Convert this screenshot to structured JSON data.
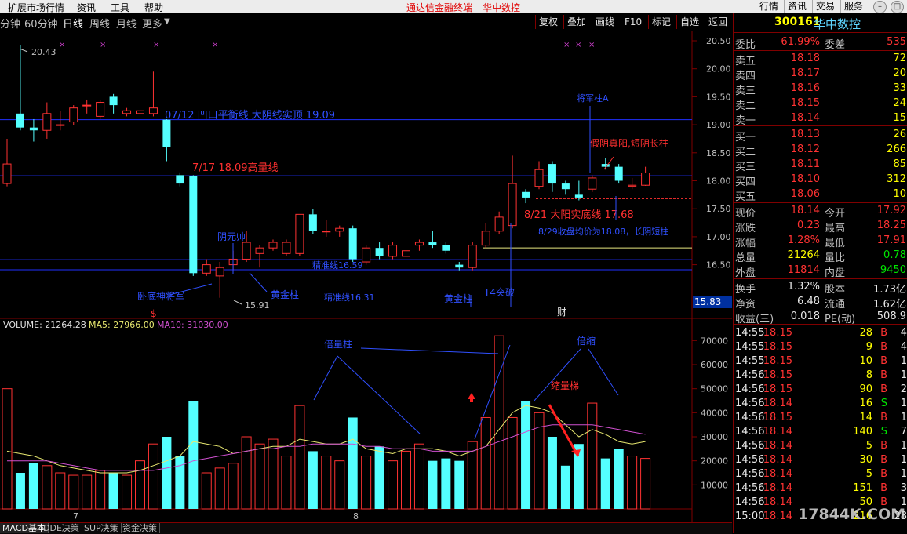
{
  "menu": {
    "items": [
      "扩展市场行情",
      "资讯",
      "工具",
      "帮助"
    ],
    "title": "通达信金融终端",
    "title_stock": "华中数控",
    "right_buttons": [
      "行情",
      "资讯",
      "交易",
      "服务"
    ]
  },
  "toolbar": {
    "periods": [
      "分钟",
      "60分钟",
      "日线",
      "周线",
      "月线",
      "更多"
    ],
    "active_period": "日线",
    "right_buttons": [
      "复权",
      "叠加",
      "画线",
      "F10",
      "标记",
      "自选",
      "返回"
    ]
  },
  "stock": {
    "code": "300161",
    "name": "华中数控"
  },
  "price_axis": [
    "20.50",
    "20.00",
    "19.50",
    "19.00",
    "18.50",
    "18.00",
    "17.50",
    "17.00",
    "16.50"
  ],
  "price_marker": "15.83",
  "hi_label": "20.43",
  "lo_label": "15.91",
  "annotations": {
    "a1": "07/12 凹口平衡线 大阴线实顶 19.09",
    "a2": "7/17 18.09高量线",
    "a3": "8/21 大阳实底线 17.68",
    "a4": "8/29收盘均价为18.08，长阴短柱",
    "a5": "将军柱A",
    "a6": "假阴真阳,短阴长柱",
    "a7": "阴元帅",
    "a8": "卧底神将军",
    "a9": "黄金柱",
    "a10": "精准线16.59",
    "a11": "精准线16.31",
    "a12": "黄金柱",
    "a13": "T4突破",
    "a14": "财",
    "s_mark": "$"
  },
  "volume": {
    "header_label": "VOLUME: 21264.28",
    "ma5_label": "MA5: 27966.00",
    "ma10_label": "MA10: 31030.00",
    "axis": [
      "70000",
      "60000",
      "50000",
      "40000",
      "30000",
      "20000",
      "10000"
    ],
    "notes": {
      "n1": "倍量柱",
      "n2": "倍缩",
      "n3": "缩量梯"
    },
    "month_labels": [
      "7",
      "8"
    ]
  },
  "quote": {
    "weibi": {
      "label": "委比",
      "pct": "61.99%",
      "diff_label": "委差",
      "diff": "535"
    },
    "asks": [
      {
        "label": "卖五",
        "price": "18.18",
        "vol": "72"
      },
      {
        "label": "卖四",
        "price": "18.17",
        "vol": "20"
      },
      {
        "label": "卖三",
        "price": "18.16",
        "vol": "33"
      },
      {
        "label": "卖二",
        "price": "18.15",
        "vol": "24"
      },
      {
        "label": "卖一",
        "price": "18.14",
        "vol": "15"
      }
    ],
    "bids": [
      {
        "label": "买一",
        "price": "18.13",
        "vol": "26"
      },
      {
        "label": "买二",
        "price": "18.12",
        "vol": "266"
      },
      {
        "label": "买三",
        "price": "18.11",
        "vol": "85"
      },
      {
        "label": "买四",
        "price": "18.10",
        "vol": "312"
      },
      {
        "label": "买五",
        "price": "18.06",
        "vol": "10"
      }
    ],
    "stats": [
      {
        "l1": "现价",
        "v1": "18.14",
        "c1": "red",
        "l2": "今开",
        "v2": "17.92",
        "c2": "red"
      },
      {
        "l1": "涨跌",
        "v1": "0.23",
        "c1": "red",
        "l2": "最高",
        "v2": "18.25",
        "c2": "red"
      },
      {
        "l1": "涨幅",
        "v1": "1.28%",
        "c1": "red",
        "l2": "最低",
        "v2": "17.91",
        "c2": "red"
      },
      {
        "l1": "总量",
        "v1": "21264",
        "c1": "yellow",
        "l2": "量比",
        "v2": "0.78",
        "c2": "green"
      },
      {
        "l1": "外盘",
        "v1": "11814",
        "c1": "red",
        "l2": "内盘",
        "v2": "9450",
        "c2": "green"
      }
    ],
    "fin": [
      {
        "l1": "换手",
        "v1": "1.32%",
        "l2": "股本",
        "v2": "1.73亿"
      },
      {
        "l1": "净资",
        "v1": "6.48",
        "l2": "流通",
        "v2": "1.62亿"
      },
      {
        "l1": "收益(三)",
        "v1": "0.018",
        "l2": "PE(动)",
        "v2": "508.9"
      }
    ],
    "ticks": [
      {
        "t": "14:55",
        "p": "18.15",
        "v": "28",
        "bs": "B",
        "n": "4"
      },
      {
        "t": "14:55",
        "p": "18.15",
        "v": "9",
        "bs": "B",
        "n": "4"
      },
      {
        "t": "14:55",
        "p": "18.15",
        "v": "10",
        "bs": "B",
        "n": "1"
      },
      {
        "t": "14:56",
        "p": "18.15",
        "v": "8",
        "bs": "B",
        "n": "1"
      },
      {
        "t": "14:56",
        "p": "18.15",
        "v": "90",
        "bs": "B",
        "n": "2"
      },
      {
        "t": "14:56",
        "p": "18.14",
        "v": "16",
        "bs": "S",
        "n": "1"
      },
      {
        "t": "14:56",
        "p": "18.15",
        "v": "14",
        "bs": "B",
        "n": "1"
      },
      {
        "t": "14:56",
        "p": "18.14",
        "v": "140",
        "bs": "S",
        "n": "7"
      },
      {
        "t": "14:56",
        "p": "18.14",
        "v": "5",
        "bs": "B",
        "n": "1"
      },
      {
        "t": "14:56",
        "p": "18.14",
        "v": "30",
        "bs": "B",
        "n": "1"
      },
      {
        "t": "14:56",
        "p": "18.14",
        "v": "5",
        "bs": "B",
        "n": "1"
      },
      {
        "t": "14:56",
        "p": "18.14",
        "v": "151",
        "bs": "B",
        "n": "3"
      },
      {
        "t": "14:56",
        "p": "18.14",
        "v": "50",
        "bs": "B",
        "n": "1"
      },
      {
        "t": "15:00",
        "p": "18.14",
        "v": "216",
        "bs": "",
        "n": "28"
      }
    ]
  },
  "tabs": [
    "MACD基本",
    "DDE决策",
    "SUP决策",
    "资金决策"
  ],
  "watermark": "17844K.COM",
  "colors": {
    "up": "#ff3232",
    "down": "#54ffff",
    "ma5": "#e8e870",
    "ma10": "#d050d0",
    "note_blue": "#3050ff",
    "note_red": "#ff3030",
    "grid": "#800000"
  },
  "candles": [
    {
      "o": 17.95,
      "c": 18.3,
      "h": 18.75,
      "l": 17.9
    },
    {
      "o": 19.2,
      "c": 18.95,
      "h": 20.43,
      "l": 18.9
    },
    {
      "o": 18.95,
      "c": 18.9,
      "h": 19.1,
      "l": 18.7
    },
    {
      "o": 18.9,
      "c": 19.2,
      "h": 19.4,
      "l": 18.75
    },
    {
      "o": 19.0,
      "c": 19.0,
      "h": 19.25,
      "l": 18.9
    },
    {
      "o": 19.05,
      "c": 19.3,
      "h": 19.35,
      "l": 19.0
    },
    {
      "o": 19.35,
      "c": 19.35,
      "h": 19.45,
      "l": 19.2
    },
    {
      "o": 19.15,
      "c": 19.4,
      "h": 19.45,
      "l": 19.1
    },
    {
      "o": 19.5,
      "c": 19.35,
      "h": 19.55,
      "l": 19.2
    },
    {
      "o": 19.2,
      "c": 19.25,
      "h": 19.3,
      "l": 19.15
    },
    {
      "o": 19.2,
      "c": 19.25,
      "h": 19.35,
      "l": 19.15
    },
    {
      "o": 19.2,
      "c": 19.3,
      "h": 19.95,
      "l": 19.15
    },
    {
      "o": 19.09,
      "c": 18.6,
      "h": 19.1,
      "l": 18.35
    },
    {
      "o": 18.1,
      "c": 17.95,
      "h": 18.15,
      "l": 17.9
    },
    {
      "o": 18.09,
      "c": 16.35,
      "h": 18.1,
      "l": 16.3
    },
    {
      "o": 16.35,
      "c": 16.5,
      "h": 16.6,
      "l": 16.3
    },
    {
      "o": 16.3,
      "c": 16.45,
      "h": 16.55,
      "l": 15.91
    },
    {
      "o": 16.5,
      "c": 16.6,
      "h": 16.75,
      "l": 16.4
    },
    {
      "o": 16.6,
      "c": 16.9,
      "h": 17.1,
      "l": 16.55
    },
    {
      "o": 16.7,
      "c": 16.8,
      "h": 16.85,
      "l": 16.45
    },
    {
      "o": 16.8,
      "c": 16.9,
      "h": 16.95,
      "l": 16.75
    },
    {
      "o": 16.7,
      "c": 16.9,
      "h": 16.95,
      "l": 16.65
    },
    {
      "o": 16.7,
      "c": 17.4,
      "h": 17.4,
      "l": 16.65
    },
    {
      "o": 17.4,
      "c": 17.1,
      "h": 17.5,
      "l": 17.05
    },
    {
      "o": 17.1,
      "c": 17.1,
      "h": 17.3,
      "l": 17.0
    },
    {
      "o": 17.1,
      "c": 17.15,
      "h": 17.2,
      "l": 17.0
    },
    {
      "o": 17.15,
      "c": 16.6,
      "h": 17.2,
      "l": 16.55
    },
    {
      "o": 16.55,
      "c": 16.8,
      "h": 16.85,
      "l": 16.5
    },
    {
      "o": 16.8,
      "c": 16.65,
      "h": 16.9,
      "l": 16.6
    },
    {
      "o": 16.65,
      "c": 16.85,
      "h": 16.9,
      "l": 16.6
    },
    {
      "o": 16.65,
      "c": 16.75,
      "h": 16.8,
      "l": 16.6
    },
    {
      "o": 16.85,
      "c": 16.9,
      "h": 16.95,
      "l": 16.75
    },
    {
      "o": 16.9,
      "c": 16.85,
      "h": 17.1,
      "l": 16.8
    },
    {
      "o": 16.85,
      "c": 16.75,
      "h": 16.9,
      "l": 16.7
    },
    {
      "o": 16.5,
      "c": 16.45,
      "h": 16.55,
      "l": 16.4
    },
    {
      "o": 16.45,
      "c": 16.85,
      "h": 16.9,
      "l": 16.4
    },
    {
      "o": 16.85,
      "c": 17.1,
      "h": 17.25,
      "l": 16.8
    },
    {
      "o": 17.1,
      "c": 17.35,
      "h": 17.45,
      "l": 17.05
    },
    {
      "o": 17.2,
      "c": 17.95,
      "h": 18.45,
      "l": 17.15
    },
    {
      "o": 17.8,
      "c": 17.7,
      "h": 17.85,
      "l": 17.6
    },
    {
      "o": 17.9,
      "c": 18.2,
      "h": 18.35,
      "l": 17.85
    },
    {
      "o": 18.3,
      "c": 17.95,
      "h": 18.35,
      "l": 17.8
    },
    {
      "o": 17.95,
      "c": 17.85,
      "h": 18.0,
      "l": 17.75
    },
    {
      "o": 17.75,
      "c": 17.7,
      "h": 18.0,
      "l": 17.65
    },
    {
      "o": 17.85,
      "c": 18.05,
      "h": 18.1,
      "l": 17.8
    },
    {
      "o": 18.3,
      "c": 18.25,
      "h": 18.4,
      "l": 18.2
    },
    {
      "o": 18.25,
      "c": 18.0,
      "h": 18.3,
      "l": 17.95
    },
    {
      "o": 17.9,
      "c": 17.92,
      "h": 18.05,
      "l": 17.85
    },
    {
      "o": 17.92,
      "c": 18.14,
      "h": 18.25,
      "l": 17.91
    }
  ],
  "volumes": [
    50,
    15,
    19,
    18,
    15,
    14,
    14,
    16,
    15,
    14,
    20,
    27,
    30,
    22,
    45,
    15,
    17,
    19,
    30,
    27,
    29,
    22,
    43,
    24,
    22,
    20,
    38,
    22,
    26,
    20,
    24,
    27,
    20,
    21,
    20,
    28,
    38,
    72,
    38,
    45,
    40,
    30,
    18,
    27,
    44,
    21,
    25,
    22,
    21
  ],
  "ma5": [
    24,
    23,
    22,
    20,
    18,
    17,
    16,
    15,
    15,
    15,
    16,
    18,
    20,
    22,
    28,
    27,
    26,
    23,
    24,
    25,
    26,
    26,
    29,
    28,
    27,
    27,
    29,
    25,
    24,
    23,
    25,
    25,
    25,
    24,
    22,
    24,
    26,
    33,
    40,
    43,
    42,
    40,
    35,
    30,
    33,
    31,
    28,
    27,
    28
  ],
  "ma10": [
    20,
    20,
    20,
    20,
    19,
    18,
    17,
    16,
    16,
    16,
    16,
    16,
    17,
    18,
    20,
    21,
    22,
    23,
    24,
    25,
    25,
    26,
    26,
    27,
    27,
    27,
    27,
    26,
    26,
    25,
    25,
    25,
    24,
    24,
    24,
    24,
    26,
    28,
    30,
    32,
    34,
    35,
    35,
    35,
    35,
    34,
    33,
    32,
    31
  ]
}
